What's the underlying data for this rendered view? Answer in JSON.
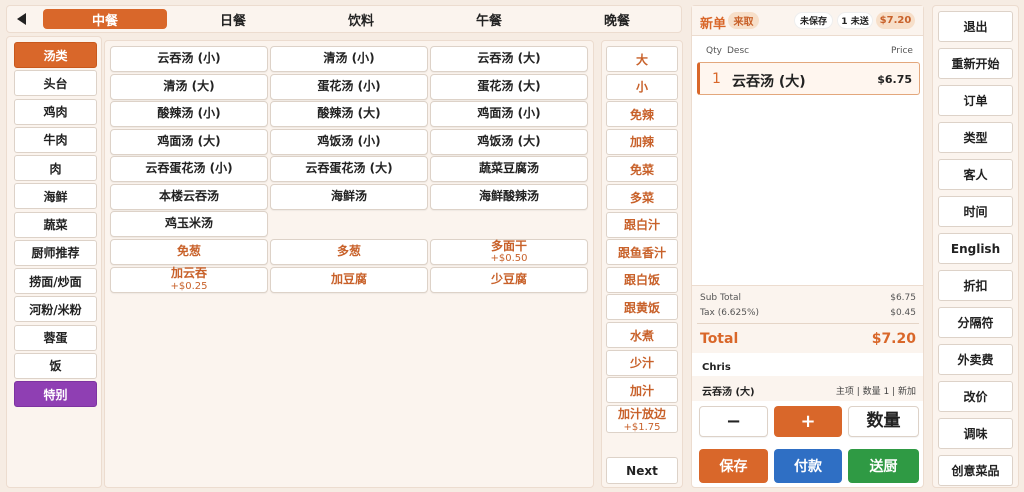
{
  "tabs": [
    {
      "label": "中餐",
      "active": true
    },
    {
      "label": "日餐"
    },
    {
      "label": "饮料"
    },
    {
      "label": "午餐"
    },
    {
      "label": "晚餐"
    }
  ],
  "categories": [
    {
      "label": "汤类",
      "state": "active"
    },
    {
      "label": "头台"
    },
    {
      "label": "鸡肉"
    },
    {
      "label": "牛肉"
    },
    {
      "label": "肉"
    },
    {
      "label": "海鲜"
    },
    {
      "label": "蔬菜"
    },
    {
      "label": "厨师推荐"
    },
    {
      "label": "捞面/炒面"
    },
    {
      "label": "河粉/米粉"
    },
    {
      "label": "蓉蛋"
    },
    {
      "label": "饭"
    },
    {
      "label": "特别",
      "state": "special"
    }
  ],
  "menu_items": [
    [
      "云吞汤 (小)",
      "清汤 (小)",
      "云吞汤 (大)"
    ],
    [
      "清汤 (大)",
      "蛋花汤 (小)",
      "蛋花汤 (大)"
    ],
    [
      "酸辣汤 (小)",
      "酸辣汤 (大)",
      "鸡面汤 (小)"
    ],
    [
      "鸡面汤 (大)",
      "鸡饭汤 (小)",
      "鸡饭汤 (大)"
    ],
    [
      "云吞蛋花汤 (小)",
      "云吞蛋花汤 (大)",
      "蔬菜豆腐汤"
    ],
    [
      "本楼云吞汤",
      "海鲜汤",
      "海鲜酸辣汤"
    ],
    [
      "鸡玉米汤"
    ]
  ],
  "item_options": [
    [
      {
        "label": "免葱"
      },
      {
        "label": "多葱"
      },
      {
        "label": "多面干",
        "price": "+$0.50"
      }
    ],
    [
      {
        "label": "加云吞",
        "price": "+$0.25"
      },
      {
        "label": "加豆腐"
      },
      {
        "label": "少豆腐"
      }
    ]
  ],
  "modifiers": [
    {
      "label": "大"
    },
    {
      "label": "小"
    },
    {
      "label": "免辣"
    },
    {
      "label": "加辣"
    },
    {
      "label": "免菜"
    },
    {
      "label": "多菜"
    },
    {
      "label": "跟白汁"
    },
    {
      "label": "跟鱼香汁"
    },
    {
      "label": "跟白饭"
    },
    {
      "label": "跟黄饭"
    },
    {
      "label": "水煮"
    },
    {
      "label": "少汁"
    },
    {
      "label": "加汁"
    },
    {
      "label": "加汁放边",
      "price": "+$1.75"
    }
  ],
  "modifiers_next": "Next",
  "order": {
    "title": "新单",
    "type_badge": "来取",
    "unsaved": "未保存",
    "unsent": "1 未送",
    "total_badge": "$7.20",
    "col_qty": "Qty",
    "col_desc": "Desc",
    "col_price": "Price",
    "lines": [
      {
        "qty": "1",
        "desc": "云吞汤 (大)",
        "price": "$6.75"
      }
    ],
    "subtotal_label": "Sub Total",
    "subtotal": "$6.75",
    "tax_label": "Tax (6.625%)",
    "tax": "$0.45",
    "total_label": "Total",
    "total": "$7.20",
    "customer": "Chris",
    "selected_item": "云吞汤 (大)",
    "selected_meta": "主项 | 数量 1 | 新加",
    "minus": "−",
    "plus": "+",
    "qty_label": "数量",
    "save": "保存",
    "pay": "付款",
    "send": "送厨"
  },
  "actions": [
    "退出",
    "重新开始",
    "订单",
    "类型",
    "客人",
    "时间",
    "English",
    "折扣",
    "分隔符",
    "外卖费",
    "改价",
    "调味",
    "创意菜品"
  ],
  "colors": {
    "accent": "#d9672a",
    "special": "#8f3fb3",
    "pay": "#2f6fc4",
    "send": "#2f9a44"
  }
}
